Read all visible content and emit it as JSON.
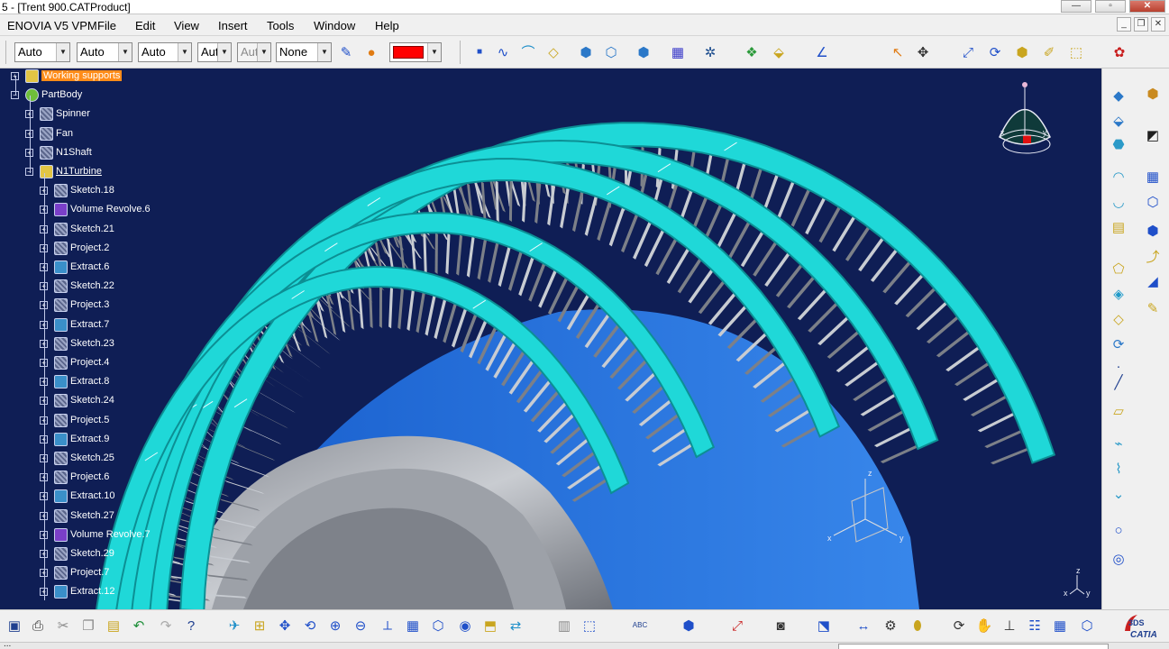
{
  "window": {
    "title": "5 - [Trent 900.CATProduct]"
  },
  "menu": {
    "items": [
      "ENOVIA V5 VPM",
      "File",
      "Edit",
      "View",
      "Insert",
      "Tools",
      "Window",
      "Help"
    ]
  },
  "toolbar_top": {
    "dropdown_1": "Auto",
    "dropdown_2": "Auto",
    "dropdown_3": "Auto",
    "dropdown_4": "Aut",
    "dropdown_5": "Aut",
    "dropdown_6": "None",
    "color_value": "#ff0000"
  },
  "tree": {
    "items": [
      {
        "label": "Working supports",
        "icon": "folder-icon",
        "highlight": true
      },
      {
        "label": "PartBody",
        "icon": "body-icon"
      },
      {
        "label": "Spinner",
        "icon": "sketch-icon"
      },
      {
        "label": "Fan",
        "icon": "sketch-icon"
      },
      {
        "label": "N1Shaft",
        "icon": "sketch-icon"
      },
      {
        "label": "N1Turbine",
        "icon": "folder-icon",
        "underline": true
      },
      {
        "label": "Sketch.18",
        "icon": "sketch-icon"
      },
      {
        "label": "Volume Revolve.6",
        "icon": "revolve-icon"
      },
      {
        "label": "Sketch.21",
        "icon": "sketch-icon"
      },
      {
        "label": "Project.2",
        "icon": "sketch-icon"
      },
      {
        "label": "Extract.6",
        "icon": "extract-icon"
      },
      {
        "label": "Sketch.22",
        "icon": "sketch-icon"
      },
      {
        "label": "Project.3",
        "icon": "sketch-icon"
      },
      {
        "label": "Extract.7",
        "icon": "extract-icon"
      },
      {
        "label": "Sketch.23",
        "icon": "sketch-icon"
      },
      {
        "label": "Project.4",
        "icon": "sketch-icon"
      },
      {
        "label": "Extract.8",
        "icon": "extract-icon"
      },
      {
        "label": "Sketch.24",
        "icon": "sketch-icon"
      },
      {
        "label": "Project.5",
        "icon": "sketch-icon"
      },
      {
        "label": "Extract.9",
        "icon": "extract-icon"
      },
      {
        "label": "Sketch.25",
        "icon": "sketch-icon"
      },
      {
        "label": "Project.6",
        "icon": "sketch-icon"
      },
      {
        "label": "Extract.10",
        "icon": "extract-icon"
      },
      {
        "label": "Sketch.27",
        "icon": "sketch-icon"
      },
      {
        "label": "Volume Revolve.7",
        "icon": "revolve-icon"
      },
      {
        "label": "Sketch.29",
        "icon": "sketch-icon"
      },
      {
        "label": "Project.7",
        "icon": "sketch-icon"
      },
      {
        "label": "Extract.12",
        "icon": "extract-icon"
      }
    ]
  },
  "compass": {
    "axis_x": "x",
    "axis_y": "y",
    "axis_z": "z"
  },
  "statusbar": {
    "text": "..."
  },
  "brand": {
    "logo_text": "CATIA",
    "logo_mark": "3DS"
  },
  "colors": {
    "viewport_bg": "#0f1e55",
    "ring": "#1fd8d8",
    "ring_dark": "#0c8f94",
    "hub": "#2a77e8",
    "blade": "#b8bec8",
    "highlight": "#ff8c19"
  }
}
